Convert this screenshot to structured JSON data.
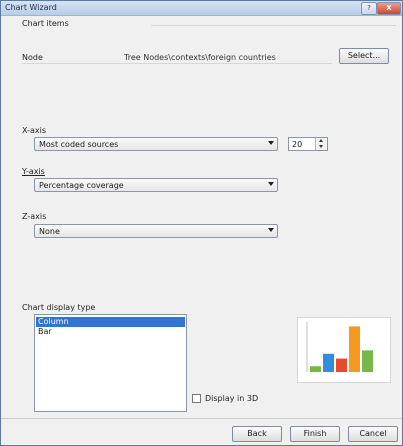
{
  "window": {
    "title": "Chart Wizard",
    "help_label": "?",
    "close_label": "X"
  },
  "chart_items": {
    "group_label": "Chart items",
    "node_label": "Node",
    "node_value": "Tree Nodes\\contexts\\foreign countries",
    "select_button": "Select..."
  },
  "x_axis": {
    "label": "X-axis",
    "value": "Most coded sources",
    "count": "20"
  },
  "y_axis": {
    "label": "Y-axis",
    "value": "Percentage coverage"
  },
  "z_axis": {
    "label": "Z-axis",
    "value": "None"
  },
  "display_type": {
    "label": "Chart display type",
    "items": [
      "Column",
      "Bar"
    ],
    "selected": "Column"
  },
  "display_3d": {
    "label": "Display in 3D",
    "checked": false
  },
  "preview": {
    "bars": [
      0.12,
      0.38,
      0.28,
      0.95,
      0.45
    ],
    "colors": [
      "#7ab648",
      "#2f8fdc",
      "#e84a2a",
      "#f39a1f",
      "#7ab648"
    ]
  },
  "footer": {
    "back": "Back",
    "finish": "Finish",
    "cancel": "Cancel"
  }
}
